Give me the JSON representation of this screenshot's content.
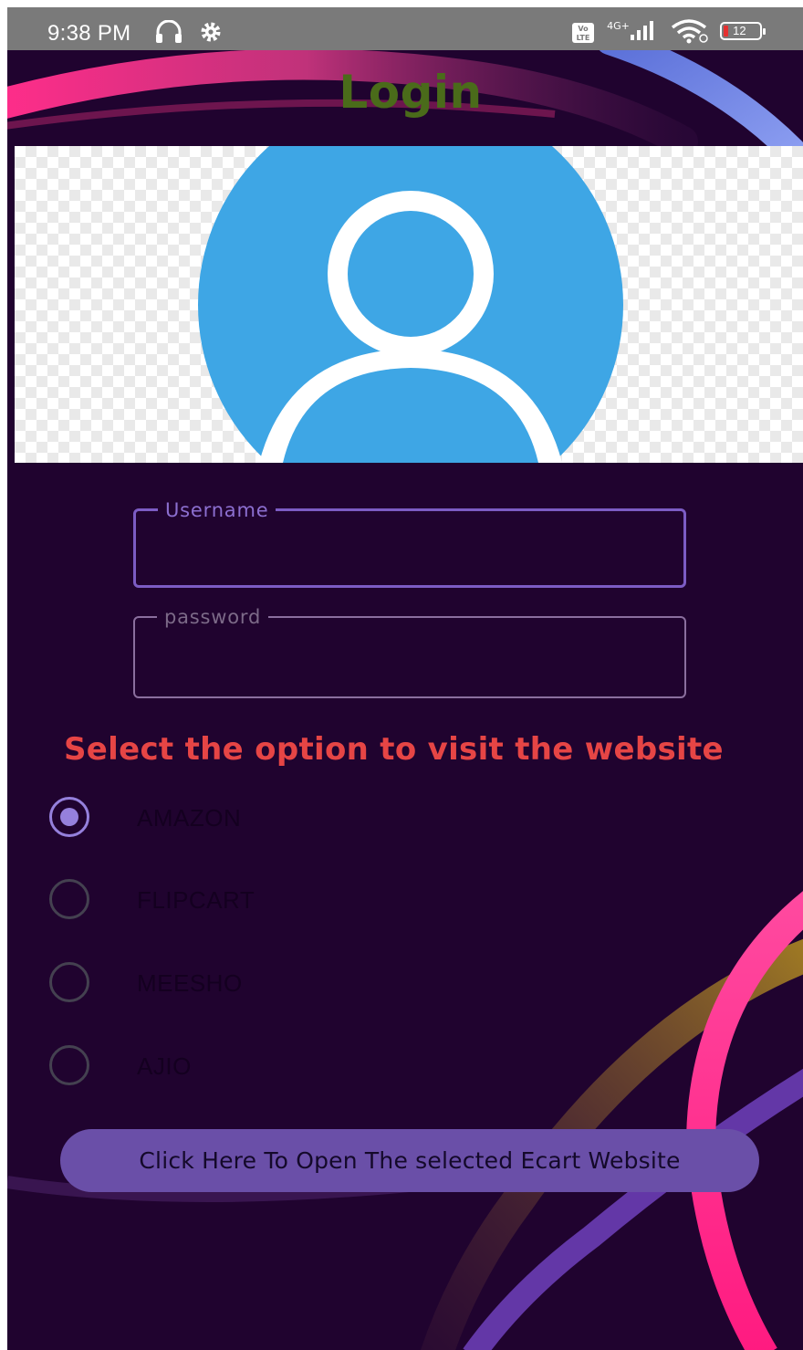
{
  "status_bar": {
    "time": "9:38 PM",
    "network_label": "4G+",
    "volte_label": "Vo LTE",
    "battery_level": "12"
  },
  "page": {
    "title": "Login"
  },
  "form": {
    "username_label": "Username",
    "password_label": "password",
    "username_value": "",
    "password_value": ""
  },
  "site_selector": {
    "prompt": "Select the option to visit the website",
    "options": [
      {
        "label": "AMAZON",
        "checked": true
      },
      {
        "label": "FLIPCART",
        "checked": false
      },
      {
        "label": "MEESHO",
        "checked": false
      },
      {
        "label": "AJIO",
        "checked": false
      }
    ]
  },
  "action": {
    "open_label": "Click Here To Open The selected Ecart Website"
  },
  "colors": {
    "background": "#20032f",
    "title": "#4a6b1a",
    "prompt": "#e64545",
    "accent": "#7c5cc4",
    "button": "#6a4fa8",
    "avatar": "#3ea6e5"
  },
  "icons": {
    "status": [
      "headset-icon",
      "gear-icon",
      "volte-icon",
      "signal-icon",
      "wifi-icon",
      "battery-icon"
    ],
    "avatar": "user-avatar-icon"
  }
}
